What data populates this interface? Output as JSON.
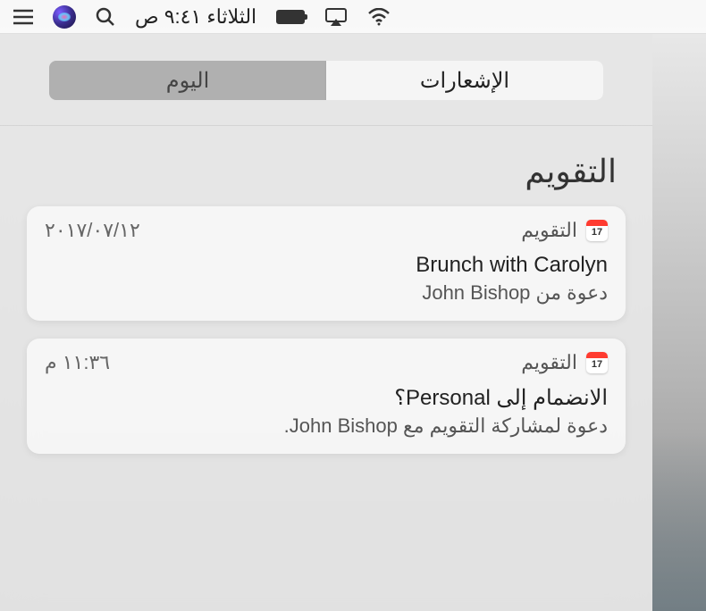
{
  "menubar": {
    "datetime": "الثلاثاء ٩:٤١ ص"
  },
  "tabs": {
    "today": "اليوم",
    "notifications": "الإشعارات"
  },
  "section": {
    "title": "التقويم"
  },
  "cards": [
    {
      "app_name": "التقويم",
      "timestamp": "٢٠١٧/٠٧/١٢",
      "title": "Brunch with Carolyn",
      "subtitle": "دعوة من John Bishop"
    },
    {
      "app_name": "التقويم",
      "timestamp": "١١:٣٦ م",
      "title": "الانضمام إلى Personal؟",
      "subtitle": "دعوة لمشاركة التقويم مع John Bishop."
    }
  ]
}
